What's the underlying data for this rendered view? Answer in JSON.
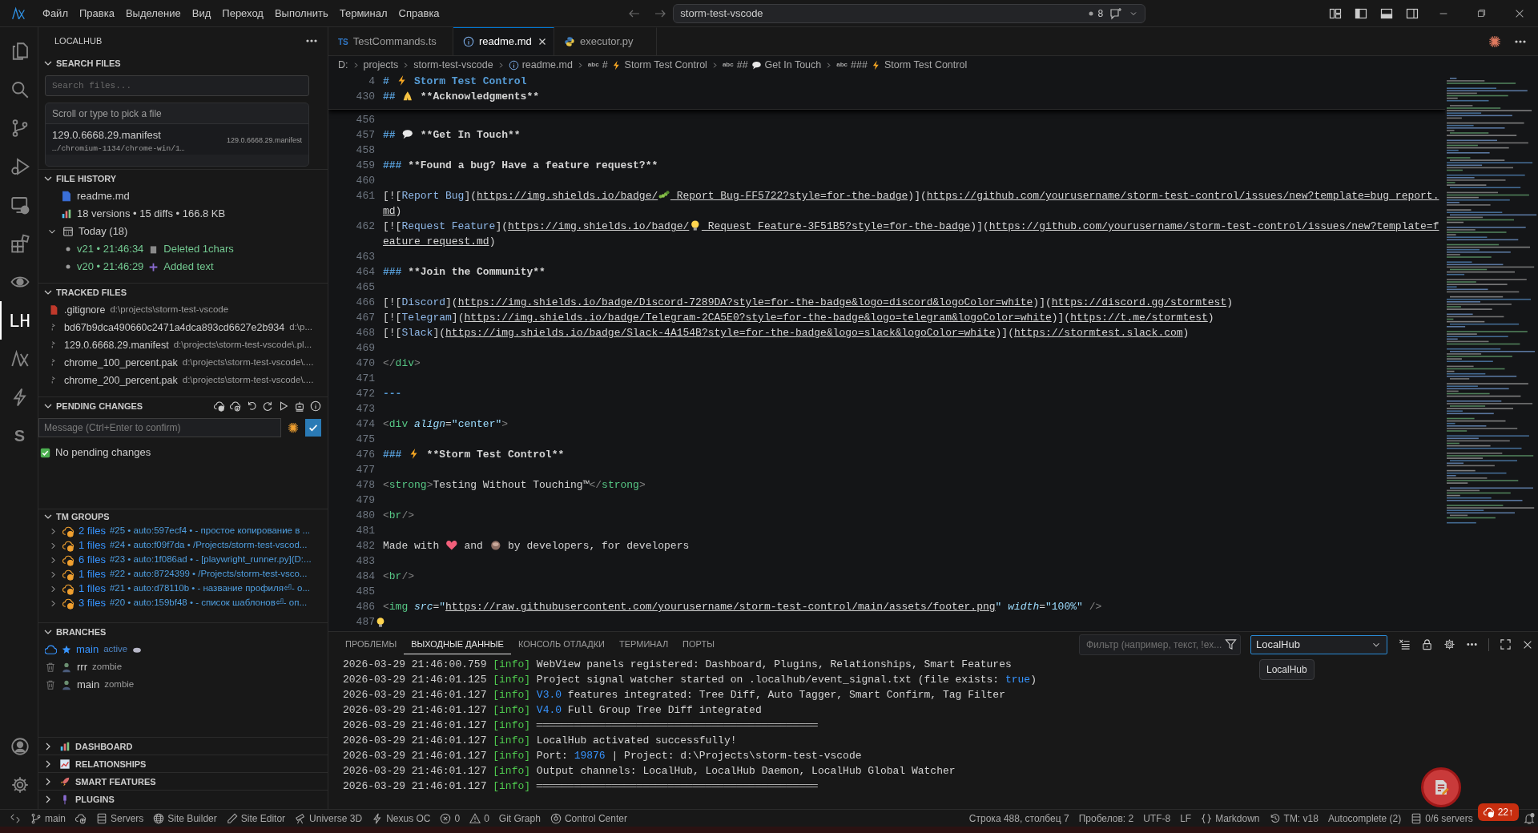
{
  "menu": [
    "Файл",
    "Правка",
    "Выделение",
    "Вид",
    "Переход",
    "Выполнить",
    "Терминал",
    "Справка"
  ],
  "command_center": {
    "text": "storm-test-vscode",
    "badge": "8"
  },
  "activity_bar": [
    {
      "kind": "files",
      "selected": false
    },
    {
      "kind": "search",
      "selected": false
    },
    {
      "kind": "branch",
      "selected": false
    },
    {
      "kind": "debug",
      "selected": false
    },
    {
      "kind": "remote",
      "selected": false
    },
    {
      "kind": "extensions",
      "selected": false
    },
    {
      "kind": "eye",
      "selected": false
    },
    {
      "kind": "text",
      "label": "LH",
      "selected": true
    },
    {
      "kind": "logo",
      "selected": false
    },
    {
      "kind": "bolt",
      "selected": false
    },
    {
      "kind": "text",
      "label": "S",
      "selected": false
    }
  ],
  "sidebar": {
    "title": "LOCALHUB",
    "search_files": {
      "title": "SEARCH FILES",
      "expanded": true,
      "placeholder": "Search files...",
      "picker_hint": "Scroll or type to pick a file",
      "results": [
        {
          "name": "129.0.6668.29.manifest",
          "path": "…/chromium-1134/chrome-win/1…",
          "detail": "129.0.6668.29.manifest"
        }
      ]
    },
    "file_history": {
      "title": "FILE HISTORY",
      "expanded": true,
      "file": "readme.md",
      "stats": "18 versions • 15 diffs • 166.8 KB",
      "group": {
        "label": "Today (18)",
        "expanded": true,
        "versions": [
          {
            "version": "v21 • 21:46:34",
            "action": "Deleted 1chars",
            "kind": "delete"
          },
          {
            "version": "v20 • 21:46:29",
            "action": "Added text",
            "kind": "add"
          }
        ]
      }
    },
    "tracked_files": {
      "title": "TRACKED FILES",
      "expanded": true,
      "files": [
        {
          "name": ".gitignore",
          "path": "d:\\projects\\storm-test-vscode",
          "kind": "git"
        },
        {
          "name": "bd67b9dca490660c2471a4dca893cd6627e2b934",
          "path": "d:\\p...",
          "kind": "file"
        },
        {
          "name": "129.0.6668.29.manifest",
          "path": "d:\\projects\\storm-test-vscode\\.pl...",
          "kind": "file"
        },
        {
          "name": "chrome_100_percent.pak",
          "path": "d:\\projects\\storm-test-vscode\\....",
          "kind": "file"
        },
        {
          "name": "chrome_200_percent.pak",
          "path": "d:\\projects\\storm-test-vscode\\....",
          "kind": "file"
        }
      ]
    },
    "pending_changes": {
      "title": "PENDING CHANGES",
      "expanded": true,
      "placeholder": "Message (Ctrl+Enter to confirm)",
      "status": "No pending changes",
      "checked": true
    },
    "tm_groups": {
      "title": "TM GROUPS",
      "expanded": true,
      "groups": [
        {
          "count": "2 files",
          "details": "#25 • auto:597ecf4 • - простое копирование в ...",
          "expanded": false
        },
        {
          "count": "1 files",
          "details": "#24 • auto:f09f7da • /Projects/storm-test-vscod...",
          "expanded": false
        },
        {
          "count": "6 files",
          "details": "#23 • auto:1f086ad • - [playwright_runner.py](D:...",
          "expanded": false
        },
        {
          "count": "1 files",
          "details": "#22 • auto:8724399 • /Projects/storm-test-vsco...",
          "expanded": false
        },
        {
          "count": "1 files",
          "details": "#21 • auto:d78110b • - название профиля⏎- о...",
          "expanded": false
        },
        {
          "count": "3 files",
          "details": "#20 • auto:159bf48 • - список шаблонов⏎- оп...",
          "expanded": false
        }
      ]
    },
    "branches": {
      "title": "BRANCHES",
      "expanded": true,
      "items": [
        {
          "name": "main",
          "status": "active",
          "active": true
        },
        {
          "name": "rrr",
          "status": "zombie",
          "active": false
        },
        {
          "name": "main",
          "status": "zombie",
          "active": false
        }
      ]
    },
    "collapsed_sections": [
      {
        "title": "DASHBOARD",
        "kind": "chart",
        "expanded": false
      },
      {
        "title": "RELATIONSHIPS",
        "kind": "trend",
        "expanded": false
      },
      {
        "title": "SMART FEATURES",
        "kind": "rocket",
        "expanded": false
      },
      {
        "title": "PLUGINS",
        "kind": "plug",
        "expanded": false
      }
    ]
  },
  "editor": {
    "tabs": [
      {
        "label": "TestCommands.ts",
        "kind": "ts",
        "badge": "TS",
        "selected": false
      },
      {
        "label": "readme.md",
        "kind": "info",
        "selected": true
      },
      {
        "label": "executor.py",
        "kind": "python",
        "selected": false
      }
    ],
    "breadcrumbs": [
      {
        "kind": "folder",
        "text": "D:"
      },
      {
        "kind": "folder",
        "text": "projects"
      },
      {
        "kind": "folder",
        "text": "storm-test-vscode"
      },
      {
        "kind": "file",
        "text": "readme.md"
      },
      {
        "kind": "heading",
        "glyph": "abc",
        "level": "#",
        "icon": {
          "kind": "bolt"
        },
        "text": "Storm Test Control"
      },
      {
        "kind": "heading",
        "glyph": "abc",
        "level": "##",
        "icon": {
          "kind": "speech"
        },
        "text": "Get In Touch"
      },
      {
        "kind": "heading",
        "glyph": "abc",
        "level": "###",
        "icon": {
          "kind": "bolt"
        },
        "text": "Storm Test Control"
      }
    ],
    "sticky": [
      {
        "num": "4",
        "segments": [
          {
            "kind": "h",
            "text": "# "
          },
          {
            "kind": "bolt"
          },
          {
            "kind": "h",
            "text": " Storm Test Control"
          }
        ]
      },
      {
        "num": "430",
        "segments": [
          {
            "kind": "h",
            "text": "## "
          },
          {
            "kind": "hands"
          },
          {
            "kind": "b",
            "text": " **Acknowledgments**"
          }
        ]
      }
    ],
    "lines": [
      {
        "num": "456"
      },
      {
        "num": "457",
        "segments": [
          {
            "kind": "h",
            "text": "## "
          },
          {
            "kind": "speech"
          },
          {
            "kind": "b",
            "text": " **Get In Touch**"
          }
        ]
      },
      {
        "num": "458"
      },
      {
        "num": "459",
        "segments": [
          {
            "kind": "h",
            "text": "### "
          },
          {
            "kind": "b",
            "text": "**Found a bug? Have a feature request?**"
          }
        ]
      },
      {
        "num": "460"
      },
      {
        "num": "461",
        "segments": [
          {
            "kind": "p",
            "text": "[!["
          },
          {
            "kind": "l",
            "text": "Report Bug"
          },
          {
            "kind": "p",
            "text": "]("
          },
          {
            "kind": "u",
            "text": "https://img.shields.io/badge/"
          },
          {
            "kind": "bug"
          },
          {
            "kind": "u",
            "text": "_Report_Bug-FF5722?style=for-the-badge"
          },
          {
            "kind": "p",
            "text": ")]("
          },
          {
            "kind": "u",
            "text": "https://github.com/yourusername/storm-test-control/issues/new?template=bug_report.md"
          },
          {
            "kind": "p",
            "text": ")"
          }
        ]
      },
      {
        "num": "462",
        "segments": [
          {
            "kind": "p",
            "text": "[!["
          },
          {
            "kind": "l",
            "text": "Request Feature"
          },
          {
            "kind": "p",
            "text": "]("
          },
          {
            "kind": "u",
            "text": "https://img.shields.io/badge/"
          },
          {
            "kind": "bulb"
          },
          {
            "kind": "u",
            "text": "_Request_Feature-3F51B5?style=for-the-badge"
          },
          {
            "kind": "p",
            "text": ")]("
          },
          {
            "kind": "u",
            "text": "https://github.com/yourusername/storm-test-control/issues/new?template=feature_request.md"
          },
          {
            "kind": "p",
            "text": ")"
          }
        ]
      },
      {
        "num": "463"
      },
      {
        "num": "464",
        "segments": [
          {
            "kind": "h",
            "text": "### "
          },
          {
            "kind": "b",
            "text": "**Join the Community**"
          }
        ]
      },
      {
        "num": "465"
      },
      {
        "num": "466",
        "segments": [
          {
            "kind": "p",
            "text": "[!["
          },
          {
            "kind": "l",
            "text": "Discord"
          },
          {
            "kind": "p",
            "text": "]("
          },
          {
            "kind": "u",
            "text": "https://img.shields.io/badge/Discord-7289DA?style=for-the-badge&logo=discord&logoColor=white"
          },
          {
            "kind": "p",
            "text": ")]("
          },
          {
            "kind": "u",
            "text": "https://discord.gg/stormtest"
          },
          {
            "kind": "p",
            "text": ")"
          }
        ]
      },
      {
        "num": "467",
        "segments": [
          {
            "kind": "p",
            "text": "[!["
          },
          {
            "kind": "l",
            "text": "Telegram"
          },
          {
            "kind": "p",
            "text": "]("
          },
          {
            "kind": "u",
            "text": "https://img.shields.io/badge/Telegram-2CA5E0?style=for-the-badge&logo=telegram&logoColor=white"
          },
          {
            "kind": "p",
            "text": ")]("
          },
          {
            "kind": "u",
            "text": "https://t.me/stormtest"
          },
          {
            "kind": "p",
            "text": ")"
          }
        ]
      },
      {
        "num": "468",
        "segments": [
          {
            "kind": "p",
            "text": "[!["
          },
          {
            "kind": "l",
            "text": "Slack"
          },
          {
            "kind": "p",
            "text": "]("
          },
          {
            "kind": "u",
            "text": "https://img.shields.io/badge/Slack-4A154B?style=for-the-badge&logo=slack&logoColor=white"
          },
          {
            "kind": "p",
            "text": ")]("
          },
          {
            "kind": "u",
            "text": "https://stormtest.slack.com"
          },
          {
            "kind": "p",
            "text": ")"
          }
        ]
      },
      {
        "num": "469"
      },
      {
        "num": "470",
        "segments": [
          {
            "kind": "g",
            "text": "</"
          },
          {
            "kind": "t",
            "text": "div"
          },
          {
            "kind": "g",
            "text": ">"
          }
        ]
      },
      {
        "num": "471"
      },
      {
        "num": "472",
        "segments": [
          {
            "kind": "h",
            "text": "---"
          }
        ]
      },
      {
        "num": "473"
      },
      {
        "num": "474",
        "segments": [
          {
            "kind": "g",
            "text": "<"
          },
          {
            "kind": "t",
            "text": "div "
          },
          {
            "kind": "a",
            "text": "align"
          },
          {
            "kind": "p",
            "text": "="
          },
          {
            "kind": "s",
            "text": "\"center\""
          },
          {
            "kind": "g",
            "text": ">"
          }
        ]
      },
      {
        "num": "475"
      },
      {
        "num": "476",
        "segments": [
          {
            "kind": "h",
            "text": "### "
          },
          {
            "kind": "bolt"
          },
          {
            "kind": "b",
            "text": " **Storm Test Control**"
          }
        ]
      },
      {
        "num": "477"
      },
      {
        "num": "478",
        "segments": [
          {
            "kind": "g",
            "text": "<"
          },
          {
            "kind": "t",
            "text": "strong"
          },
          {
            "kind": "g",
            "text": ">"
          },
          {
            "kind": "p",
            "text": "Testing Without Touching™"
          },
          {
            "kind": "g",
            "text": "</"
          },
          {
            "kind": "t",
            "text": "strong"
          },
          {
            "kind": "g",
            "text": ">"
          }
        ]
      },
      {
        "num": "479"
      },
      {
        "num": "480",
        "segments": [
          {
            "kind": "g",
            "text": "<"
          },
          {
            "kind": "t",
            "text": "br"
          },
          {
            "kind": "g",
            "text": "/>"
          }
        ]
      },
      {
        "num": "481"
      },
      {
        "num": "482",
        "segments": [
          {
            "kind": "p",
            "text": "Made with "
          },
          {
            "kind": "heart"
          },
          {
            "kind": "p",
            "text": " and "
          },
          {
            "kind": "cup"
          },
          {
            "kind": "p",
            "text": " by developers, for developers"
          }
        ]
      },
      {
        "num": "483"
      },
      {
        "num": "484",
        "segments": [
          {
            "kind": "g",
            "text": "<"
          },
          {
            "kind": "t",
            "text": "br"
          },
          {
            "kind": "g",
            "text": "/>"
          }
        ]
      },
      {
        "num": "485"
      },
      {
        "num": "486",
        "segments": [
          {
            "kind": "g",
            "text": "<"
          },
          {
            "kind": "t",
            "text": "img "
          },
          {
            "kind": "a",
            "text": "src"
          },
          {
            "kind": "p",
            "text": "="
          },
          {
            "kind": "s",
            "text": "\""
          },
          {
            "kind": "u",
            "text": "https://raw.githubusercontent.com/yourusername/storm-test-control/main/assets/footer.png"
          },
          {
            "kind": "s",
            "text": "\" "
          },
          {
            "kind": "a",
            "text": "width"
          },
          {
            "kind": "p",
            "text": "="
          },
          {
            "kind": "s",
            "text": "\"100%\" "
          },
          {
            "kind": "g",
            "text": "/>"
          }
        ]
      },
      {
        "num": "487",
        "code_action": true
      }
    ]
  },
  "panel": {
    "tabs": [
      {
        "label": "ПРОБЛЕМЫ",
        "selected": false
      },
      {
        "label": "ВЫХОДНЫЕ ДАННЫЕ",
        "selected": true
      },
      {
        "label": "КОНСОЛЬ ОТЛАДКИ",
        "selected": false
      },
      {
        "label": "ТЕРМИНАЛ",
        "selected": false
      },
      {
        "label": "ПОРТЫ",
        "selected": false
      }
    ],
    "filter_placeholder": "Фильтр (например, текст, !ex...",
    "channel": "LocalHub",
    "tooltip": "LocalHub",
    "output": [
      {
        "time": "2026-03-29 21:46:00.759",
        "level": "[info]",
        "segments": [
          {
            "kind": "p",
            "text": "WebView panels registered: Dashboard, Plugins, Relationships, Smart Features"
          }
        ]
      },
      {
        "time": "2026-03-29 21:46:01.125",
        "level": "[info]",
        "segments": [
          {
            "kind": "p",
            "text": "Project signal watcher started on .localhub/event_signal.txt (file exists: "
          },
          {
            "kind": "n",
            "text": "true"
          },
          {
            "kind": "p",
            "text": ")"
          }
        ]
      },
      {
        "time": "2026-03-29 21:46:01.127",
        "level": "[info]",
        "segments": [
          {
            "kind": "n",
            "text": "V3.0"
          },
          {
            "kind": "p",
            "text": " features integrated: Tree Diff, Auto Tagger, Smart Confirm, Tag Filter"
          }
        ]
      },
      {
        "time": "2026-03-29 21:46:01.127",
        "level": "[info]",
        "segments": [
          {
            "kind": "n",
            "text": "V4.0"
          },
          {
            "kind": "p",
            "text": " Full Group Tree Diff integrated"
          }
        ]
      },
      {
        "time": "2026-03-29 21:46:01.127",
        "level": "[info]",
        "segments": [
          {
            "kind": "p",
            "text": "═════════════════════════════════════════════"
          }
        ]
      },
      {
        "time": "2026-03-29 21:46:01.127",
        "level": "[info]",
        "segments": [
          {
            "kind": "p",
            "text": "LocalHub activated successfully!"
          }
        ]
      },
      {
        "time": "2026-03-29 21:46:01.127",
        "level": "[info]",
        "segments": [
          {
            "kind": "p",
            "text": "Port: "
          },
          {
            "kind": "n",
            "text": "19876"
          },
          {
            "kind": "p",
            "text": " | Project: d:\\Projects\\storm-test-vscode"
          }
        ]
      },
      {
        "time": "2026-03-29 21:46:01.127",
        "level": "[info]",
        "segments": [
          {
            "kind": "p",
            "text": "Output channels: LocalHub, LocalHub Daemon, LocalHub Global Watcher"
          }
        ]
      },
      {
        "time": "2026-03-29 21:46:01.127",
        "level": "[info]",
        "segments": [
          {
            "kind": "p",
            "text": "═════════════════════════════════════════════"
          }
        ]
      }
    ]
  },
  "status_bar": {
    "left": [
      {
        "kind": "remote"
      },
      {
        "kind": "branch",
        "text": "main"
      },
      {
        "kind": "cloudsync"
      },
      {
        "kind": "servers",
        "text": "Servers"
      },
      {
        "kind": "globe",
        "text": "Site Builder"
      },
      {
        "kind": "pencil",
        "text": "Site Editor"
      },
      {
        "kind": "telescope",
        "text": "Universe 3D"
      },
      {
        "kind": "bolt",
        "text": "Nexus OC"
      },
      {
        "kind": "error",
        "text": "0"
      },
      {
        "kind": "warning",
        "text": "0"
      },
      {
        "kind": "text",
        "text": "Git Graph"
      },
      {
        "kind": "radio",
        "text": "Control Center"
      }
    ],
    "right": [
      {
        "kind": "text",
        "text": "Строка 488, столбец 7"
      },
      {
        "kind": "text",
        "text": "Пробелов: 2"
      },
      {
        "kind": "text",
        "text": "UTF-8"
      },
      {
        "kind": "text",
        "text": "LF"
      },
      {
        "kind": "braces",
        "text": "Markdown"
      },
      {
        "kind": "history",
        "text": "TM: v18"
      },
      {
        "kind": "text",
        "text": "Autocomplete (2)"
      },
      {
        "kind": "servers",
        "text": "0/6 servers"
      },
      {
        "kind": "cloudup",
        "text": "22↑",
        "alert": true
      },
      {
        "kind": "bell"
      }
    ]
  }
}
